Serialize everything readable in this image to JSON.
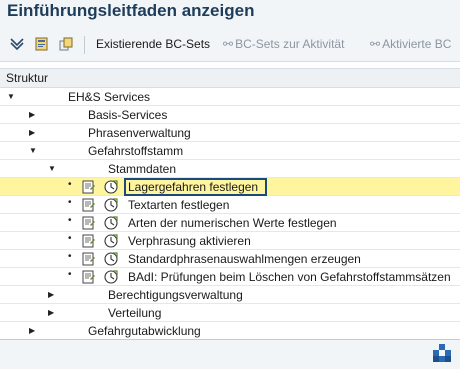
{
  "title": "Einführungsleitfaden anzeigen",
  "toolbar": {
    "existing_bc_sets": "Existierende BC-Sets",
    "bc_sets_activity": "BC-Sets zur Aktivität",
    "activated_bc": "Aktivierte BC"
  },
  "structure_header": "Struktur",
  "tree": {
    "root": "EH&S Services",
    "basis_services": "Basis-Services",
    "phrasenverwaltung": "Phrasenverwaltung",
    "gefahrstoffstamm": "Gefahrstoffstamm",
    "stammdaten": "Stammdaten",
    "items": [
      "Lagergefahren festlegen",
      "Textarten festlegen",
      "Arten der numerischen Werte festlegen",
      "Verphrasung aktivieren",
      "Standardphrasenauswahlmengen erzeugen",
      "BAdI: Prüfungen beim Löschen von Gefahrstoffstammsätzen"
    ],
    "berechtigungsverwaltung": "Berechtigungsverwaltung",
    "verteilung": "Verteilung",
    "gefahrgutabwicklung": "Gefahrgutabwicklung"
  },
  "colors": {
    "selection": "#fff59e",
    "focus_border": "#1a4a7a",
    "title_text": "#1e3d5a"
  }
}
